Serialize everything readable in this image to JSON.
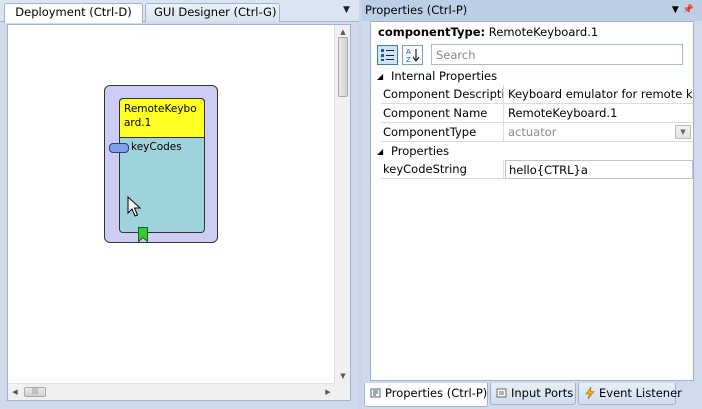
{
  "left_panel": {
    "tabs": [
      {
        "label": "Deployment (Ctrl-D)",
        "active": true
      },
      {
        "label": "GUI Designer (Ctrl-G)",
        "active": false
      }
    ],
    "component": {
      "title": "RemoteKeyboard.1",
      "input_port": "keyCodes",
      "colors": {
        "frame": "#ccccf4",
        "body": "#9fd3dc",
        "title": "#ffff22",
        "input_port": "#7f9fe6",
        "event_port": "#33cc33"
      }
    }
  },
  "right_panel": {
    "title": "Properties (Ctrl-P)",
    "component_type_label": "componentType:",
    "component_type_value": "RemoteKeyboard.1",
    "search_placeholder": "Search",
    "sections": [
      {
        "label": "Internal Properties",
        "rows": [
          {
            "name": "Component Description",
            "value": "Keyboard emulator for remote keyboard"
          },
          {
            "name": "Component Name",
            "value": "RemoteKeyboard.1"
          },
          {
            "name": "ComponentType",
            "value": "actuator"
          }
        ]
      },
      {
        "label": "Properties",
        "rows": [
          {
            "name": "keyCodeString",
            "value": "hello{CTRL}a"
          }
        ]
      }
    ],
    "bottom_tabs": [
      {
        "label": "Properties (Ctrl-P)",
        "icon": "properties-icon",
        "active": true
      },
      {
        "label": "Input Ports",
        "icon": "input-ports-icon",
        "active": false
      },
      {
        "label": "Event Listener",
        "icon": "lightning-icon",
        "active": false
      }
    ]
  }
}
